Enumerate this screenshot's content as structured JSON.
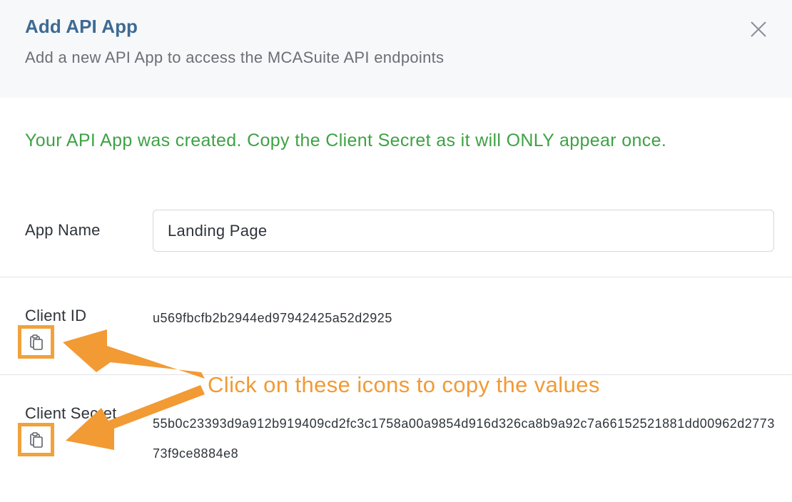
{
  "header": {
    "title": "Add API App",
    "subtitle": "Add a new API App to access the MCASuite API endpoints",
    "close_icon": "close-icon"
  },
  "success_message": "Your API App was created. Copy the Client Secret as it will ONLY appear once.",
  "form": {
    "app_name_label": "App Name",
    "app_name_value": "Landing Page",
    "client_id_label": "Client ID",
    "client_id_value": "u569fbcfb2b2944ed97942425a52d2925",
    "client_secret_label": "Client Secret",
    "client_secret_value": "55b0c23393d9a912b919409cd2fc3c1758a00a9854d916d326ca8b9a92c7a66152521881dd00962d277373f9ce8884e8",
    "copy_icon": "clipboard-icon"
  },
  "annotation": {
    "text": "Click on these icons to copy the values",
    "color": "#f29a34",
    "highlight_color": "#f0a23d"
  },
  "colors": {
    "title": "#3d6a93",
    "success": "#3ea245",
    "header_bg": "#f7f8fa"
  }
}
